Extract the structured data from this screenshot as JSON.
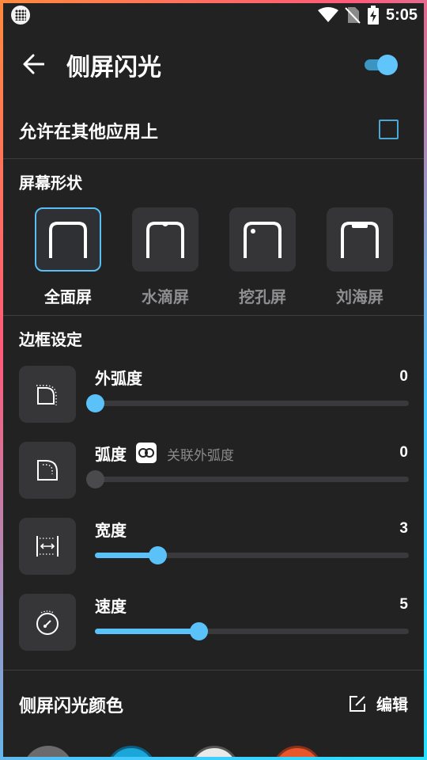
{
  "status_bar": {
    "time": "5:05"
  },
  "app_bar": {
    "title": "侧屏闪光",
    "enabled": true
  },
  "overlay": {
    "label": "允许在其他应用上",
    "checked": false
  },
  "screen_shape": {
    "title": "屏幕形状",
    "options": [
      {
        "label": "全面屏",
        "selected": true
      },
      {
        "label": "水滴屏",
        "selected": false
      },
      {
        "label": "挖孔屏",
        "selected": false
      },
      {
        "label": "刘海屏",
        "selected": false
      }
    ]
  },
  "border": {
    "title": "边框设定",
    "sliders": [
      {
        "label": "外弧度",
        "value": "0",
        "level": 0,
        "icon": "outer-corner-icon"
      },
      {
        "label": "弧度",
        "value": "0",
        "level": 0,
        "icon": "inner-corner-icon",
        "link_label": "关联外弧度",
        "disabled": true
      },
      {
        "label": "宽度",
        "value": "3",
        "level": 0.2,
        "icon": "width-icon"
      },
      {
        "label": "速度",
        "value": "5",
        "level": 0.33,
        "icon": "speed-icon"
      }
    ]
  },
  "color": {
    "title": "侧屏闪光颜色",
    "edit_label": "编辑"
  },
  "colors": {
    "accent": "#5ac2f8",
    "background": "#222223",
    "card": "#363638"
  }
}
